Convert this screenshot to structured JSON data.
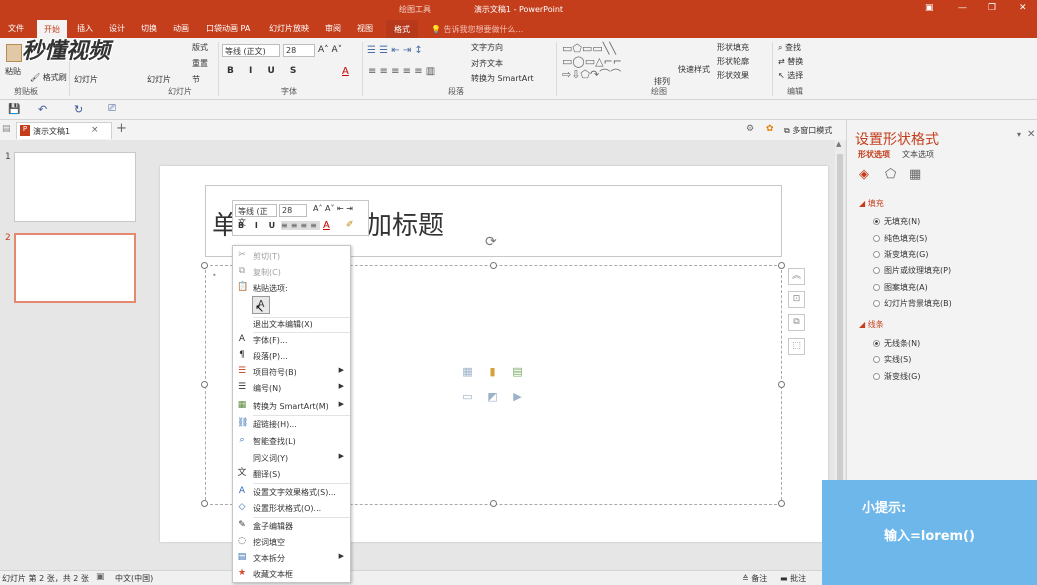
{
  "titlebar": {
    "title": "演示文稿1 - PowerPoint",
    "tools": "绘图工具"
  },
  "tabs": [
    {
      "label": "文件"
    },
    {
      "label": "开始"
    },
    {
      "label": "插入"
    },
    {
      "label": "设计"
    },
    {
      "label": "切换"
    },
    {
      "label": "动画"
    },
    {
      "label": "口袋动画 PA"
    },
    {
      "label": "幻灯片放映"
    },
    {
      "label": "审阅"
    },
    {
      "label": "视图"
    },
    {
      "label": "格式"
    }
  ],
  "tellme": "告诉我您想要做什么...",
  "ribbon": {
    "groups": {
      "clipboard": "剪贴板",
      "slides": "幻灯片",
      "font": "字体",
      "paragraph": "段落",
      "drawing": "绘图",
      "editing": "编辑"
    },
    "paste": "粘贴",
    "format_painter": "格式刷",
    "new_slide_1": "幻灯片",
    "reuse_slide": "幻灯片",
    "layout": "版式",
    "reset": "重置",
    "section": "节",
    "font_name": "等线 (正文)",
    "font_size": "28",
    "text_direction": "文字方向",
    "align_text": "对齐文本",
    "to_smartart": "转换为 SmartArt",
    "arrange": "排列",
    "quick_styles": "快速样式",
    "shape_fill": "形状填充",
    "shape_outline": "形状轮廓",
    "shape_effects": "形状效果",
    "find": "查找",
    "replace": "替换",
    "select": "选择"
  },
  "logo_text": "秒懂视频",
  "doctab": {
    "name": "演示文稿1"
  },
  "multiwindow": "多窗口模式",
  "thumbnails": [
    {
      "num": "1"
    },
    {
      "num": "2"
    }
  ],
  "slide": {
    "title_partial_left": "单",
    "title_partial_right": "加标题"
  },
  "minibar": {
    "font": "等线 (正文",
    "size": "28"
  },
  "context_menu": [
    {
      "icon": "scissors",
      "label": "剪切(T)",
      "disabled": true
    },
    {
      "icon": "copy",
      "label": "复制(C)",
      "disabled": true
    },
    {
      "icon": "paste",
      "label": "粘贴选项:",
      "disabled": false
    },
    {
      "icon": "",
      "label": "退出文本编辑(X)",
      "disabled": false
    },
    {
      "icon": "A",
      "label": "字体(F)...",
      "disabled": false
    },
    {
      "icon": "¶",
      "label": "段落(P)...",
      "disabled": false
    },
    {
      "icon": "≡",
      "label": "项目符号(B)",
      "disabled": false,
      "submenu": true
    },
    {
      "icon": "≡",
      "label": "编号(N)",
      "disabled": false,
      "submenu": true
    },
    {
      "icon": "▦",
      "label": "转换为 SmartArt(M)",
      "disabled": false,
      "submenu": true
    },
    {
      "icon": "⛓",
      "label": "超链接(H)...",
      "disabled": false
    },
    {
      "icon": "⌕",
      "label": "智能查找(L)",
      "disabled": false
    },
    {
      "icon": "",
      "label": "同义词(Y)",
      "disabled": false,
      "submenu": true
    },
    {
      "icon": "文",
      "label": "翻译(S)",
      "disabled": false
    },
    {
      "icon": "A",
      "label": "设置文字效果格式(S)...",
      "disabled": false
    },
    {
      "icon": "◇",
      "label": "设置形状格式(O)...",
      "disabled": false
    },
    {
      "icon": "✎",
      "label": "盒子编辑器",
      "disabled": false
    },
    {
      "icon": "◌",
      "label": "挖词填空",
      "disabled": false
    },
    {
      "icon": "▤",
      "label": "文本拆分",
      "disabled": false,
      "submenu": true
    },
    {
      "icon": "★",
      "label": "收藏文本框",
      "disabled": false
    }
  ],
  "format_pane": {
    "title": "设置形状格式",
    "tab_shape": "形状选项",
    "tab_text": "文本选项",
    "fill_section": "填充",
    "fill_options": [
      "无填充(N)",
      "纯色填充(S)",
      "渐变填充(G)",
      "图片或纹理填充(P)",
      "图案填充(A)",
      "幻灯片背景填充(B)"
    ],
    "line_section": "线条",
    "line_options": [
      "无线条(N)",
      "实线(S)",
      "渐变线(G)"
    ]
  },
  "status": {
    "slide_info": "幻灯片 第 2 张，共 2 张",
    "language": "中文(中国)",
    "notes": "备注",
    "comments": "批注"
  },
  "tip": {
    "heading": "小提示:",
    "body": "输入=lorem()"
  },
  "colors": {
    "accent": "#c43e1c",
    "tip_bg": "#6db7ea"
  }
}
